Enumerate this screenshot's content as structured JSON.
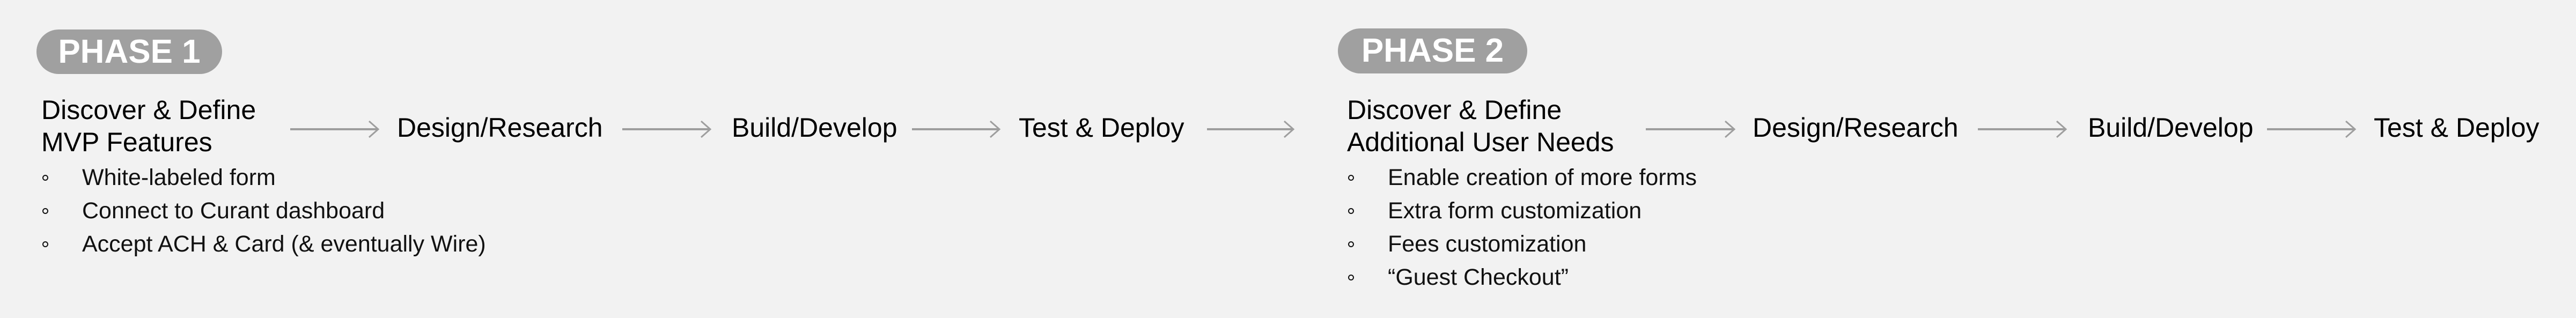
{
  "colors": {
    "background": "#f2f2f2",
    "pill": "#a0a0a0",
    "pill_text": "#ffffff",
    "arrow": "#9e9e9e",
    "text": "#000000"
  },
  "phases": [
    {
      "badge": "PHASE 1",
      "heading": [
        "Discover & Define",
        "MVP Features"
      ],
      "bullets": [
        "White-labeled form",
        "Connect to Curant dashboard",
        "Accept ACH & Card (& eventually Wire)"
      ],
      "steps": [
        "Design/Research",
        "Build/Develop",
        "Test & Deploy"
      ]
    },
    {
      "badge": "PHASE 2",
      "heading": [
        "Discover & Define",
        "Additional User Needs"
      ],
      "bullets": [
        "Enable creation of more forms",
        "Extra form customization",
        "Fees customization",
        "“Guest Checkout”"
      ],
      "steps": [
        "Design/Research",
        "Build/Develop",
        "Test & Deploy"
      ]
    }
  ],
  "icons": {
    "arrow": "arrow-right-icon",
    "bullet": "hollow-circle-bullet"
  }
}
